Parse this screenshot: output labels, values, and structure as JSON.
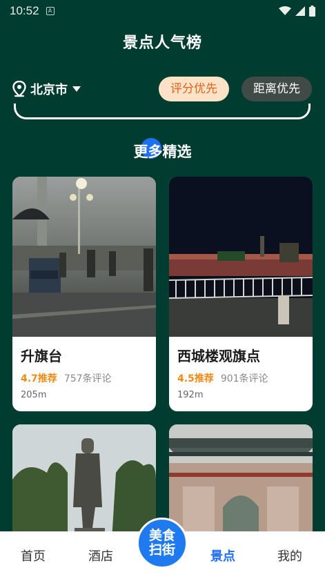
{
  "status_bar": {
    "time": "10:52",
    "notification_icon": "A"
  },
  "header": {
    "title": "景点人气榜"
  },
  "location": {
    "city": "北京市"
  },
  "sort_options": [
    {
      "label": "评分优先",
      "active": true
    },
    {
      "label": "距离优先",
      "active": false
    }
  ],
  "section": {
    "title": "更多精选"
  },
  "cards": [
    {
      "name": "升旗台",
      "rating": "4.7推荐",
      "reviews": "757条评论",
      "distance": "205m"
    },
    {
      "name": "西城楼观旗点",
      "rating": "4.5推荐",
      "reviews": "901条评论",
      "distance": "192m"
    },
    {
      "name": "",
      "rating": "",
      "reviews": "",
      "distance": ""
    },
    {
      "name": "",
      "rating": "",
      "reviews": "",
      "distance": ""
    }
  ],
  "tabbar": {
    "home": "首页",
    "hotel": "酒店",
    "center_line1": "美食",
    "center_line2": "扫街",
    "attractions": "景点",
    "mine": "我的"
  },
  "colors": {
    "background": "#003d30",
    "accent": "#1f6ff2",
    "rating": "#f08a14",
    "active_pill_bg": "#fde2c8",
    "active_pill_text": "#e0641c"
  }
}
